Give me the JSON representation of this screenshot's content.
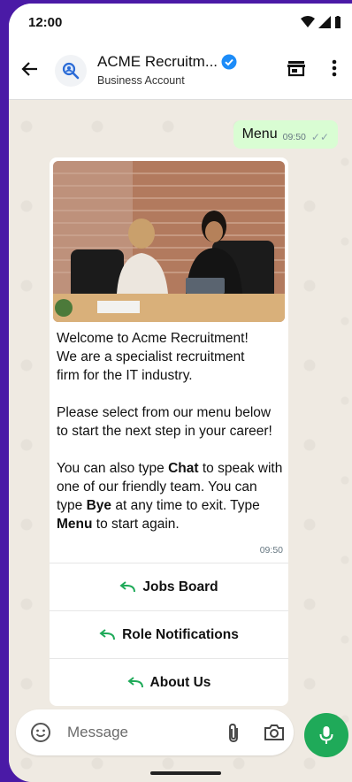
{
  "status": {
    "time": "12:00",
    "icons": [
      "wifi-icon",
      "signal-icon",
      "battery-icon"
    ]
  },
  "header": {
    "title": "ACME Recruitm...",
    "subtitle": "Business Account",
    "icons": [
      "back-arrow-icon",
      "avatar-search-icon",
      "verified-badge-icon",
      "storefront-icon",
      "more-vertical-icon"
    ]
  },
  "sent_message": {
    "text": "Menu",
    "time": "09:50"
  },
  "received_message": {
    "line1": "Welcome to Acme Recruitment!",
    "line2": "We are  a specialist recruitment",
    "line3": "firm for the IT industry.",
    "para2": "Please select from our menu below to start the next step in your career!",
    "p3_a": "You can also type ",
    "p3_chat": "Chat",
    "p3_b": " to speak with one of our friendly team.   You can type ",
    "p3_bye": "Bye",
    "p3_c": " at any time to exit. Type ",
    "p3_menu": "Menu",
    "p3_d": " to start again.",
    "time": "09:50"
  },
  "buttons": [
    {
      "label": "Jobs Board",
      "icon": "reply-arrow-icon"
    },
    {
      "label": "Role Notifications",
      "icon": "reply-arrow-icon"
    },
    {
      "label": "About Us",
      "icon": "reply-arrow-icon"
    }
  ],
  "composer": {
    "placeholder": "Message",
    "icons": [
      "emoji-icon",
      "attach-icon",
      "camera-icon",
      "mic-icon"
    ]
  },
  "colors": {
    "accent_green": "#1faa59",
    "sent_bubble": "#d9fdd3",
    "chat_background": "#efeae2",
    "verified_blue": "#1d8cf8",
    "reply_icon": "#1faa59",
    "page_frame": "#4a1aa6"
  }
}
